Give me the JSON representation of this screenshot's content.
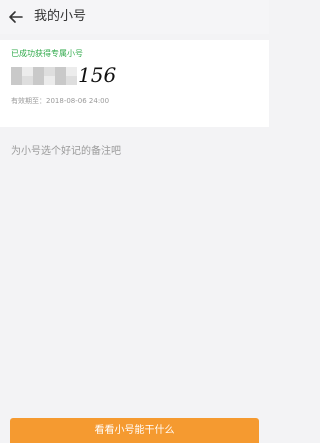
{
  "header": {
    "title": "我的小号",
    "back_icon": "back-arrow-icon"
  },
  "card": {
    "success_text": "已成功获得专属小号",
    "number_visible_suffix": "156",
    "validity_text": "有效期至：2018-08-06 24:00"
  },
  "remark": {
    "hint": "为小号选个好记的备注吧"
  },
  "footer": {
    "button_label": "看看小号能干什么"
  },
  "colors": {
    "success": "#2faa4a",
    "accent": "#f59a30",
    "background": "#f3f3f5"
  }
}
